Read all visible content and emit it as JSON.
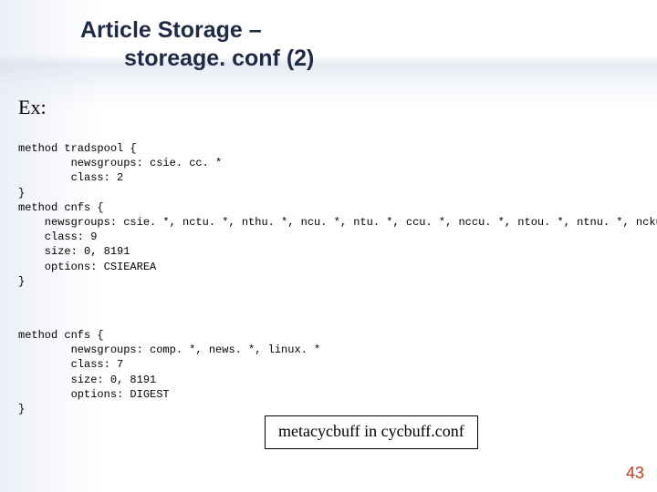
{
  "title": {
    "line1": "Article Storage –",
    "line2": "storeage. conf (2)"
  },
  "ex_label": "Ex:",
  "code_block_1": "method tradspool {\n        newsgroups: csie. cc. *\n        class: 2\n}\nmethod cnfs {\n    newsgroups: csie. *, nctu. *, nthu. *, ncu. *, ntu. *, ccu. *, nccu. *, ntou. *, ntnu. *, ncku*,  eecsep. *\n    class: 9\n    size: 0, 8191\n    options: CSIEAREA\n}",
  "code_block_2": "method cnfs {\n        newsgroups: comp. *, news. *, linux. *\n        class: 7\n        size: 0, 8191\n        options: DIGEST\n}",
  "callout": "metacycbuff in cycbuff.conf",
  "page_number": "43"
}
